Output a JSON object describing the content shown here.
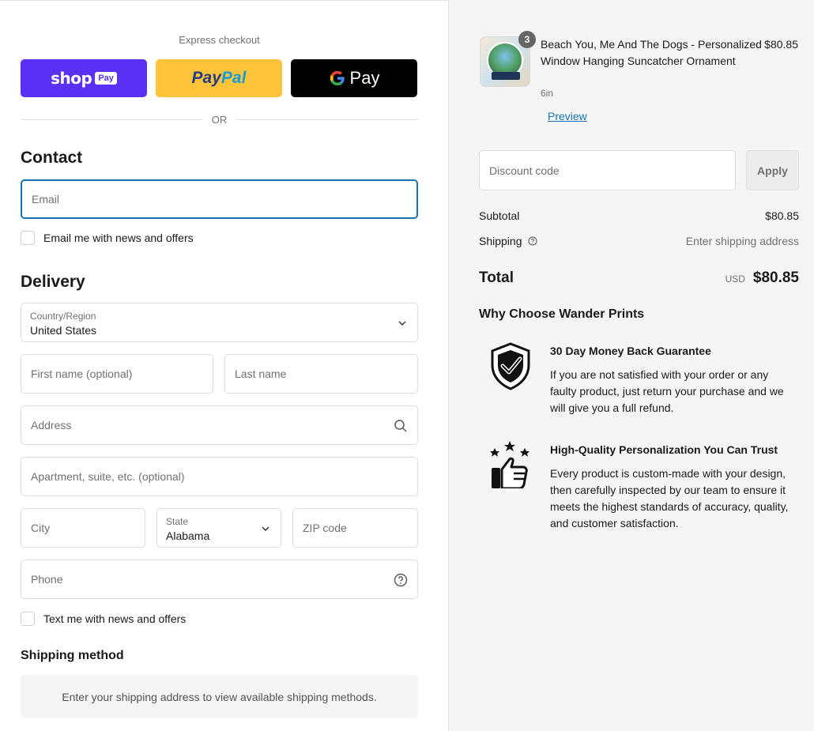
{
  "express": {
    "title": "Express checkout",
    "shop_pay": {
      "word": "shop",
      "chip": "Pay"
    },
    "paypal": {
      "part1": "Pay",
      "part2": "Pal"
    },
    "gpay": {
      "g": "G",
      "pay": "Pay"
    },
    "or": "OR"
  },
  "contact": {
    "heading": "Contact",
    "email_placeholder": "Email",
    "newsletter_label": "Email me with news and offers"
  },
  "delivery": {
    "heading": "Delivery",
    "country_label": "Country/Region",
    "country_value": "United States",
    "first_name_placeholder": "First name (optional)",
    "last_name_placeholder": "Last name",
    "address_placeholder": "Address",
    "apartment_placeholder": "Apartment, suite, etc. (optional)",
    "city_placeholder": "City",
    "state_label": "State",
    "state_value": "Alabama",
    "zip_placeholder": "ZIP code",
    "phone_placeholder": "Phone",
    "sms_label": "Text me with news and offers"
  },
  "shipping_method": {
    "heading": "Shipping method",
    "message": "Enter your shipping address to view available shipping methods."
  },
  "summary": {
    "item": {
      "quantity": "3",
      "title": "Beach You, Me And The Dogs - Personalized Window Hanging Suncatcher Ornament",
      "variant": "6in",
      "price": "$80.85",
      "preview_label": "Preview"
    },
    "discount_placeholder": "Discount code",
    "apply_label": "Apply",
    "subtotal_label": "Subtotal",
    "subtotal_value": "$80.85",
    "shipping_label": "Shipping",
    "shipping_value": "Enter shipping address",
    "total_label": "Total",
    "currency": "USD",
    "total_value": "$80.85"
  },
  "why": {
    "heading": "Why Choose Wander Prints",
    "features": [
      {
        "title": "30 Day Money Back Guarantee",
        "text": "If you are not satisfied with your order or any faulty product, just return your purchase and we will give you a full refund."
      },
      {
        "title": "High-Quality Personalization You Can Trust",
        "text": "Every product is custom-made with your design, then carefully inspected by our team to ensure it meets the highest standards of accuracy, quality, and customer satisfaction."
      }
    ]
  },
  "colors": {
    "shop_pay": "#5a31f4",
    "paypal": "#ffc439",
    "gpay": "#000000",
    "link": "#1773b0",
    "focus_border": "#1773b0"
  }
}
